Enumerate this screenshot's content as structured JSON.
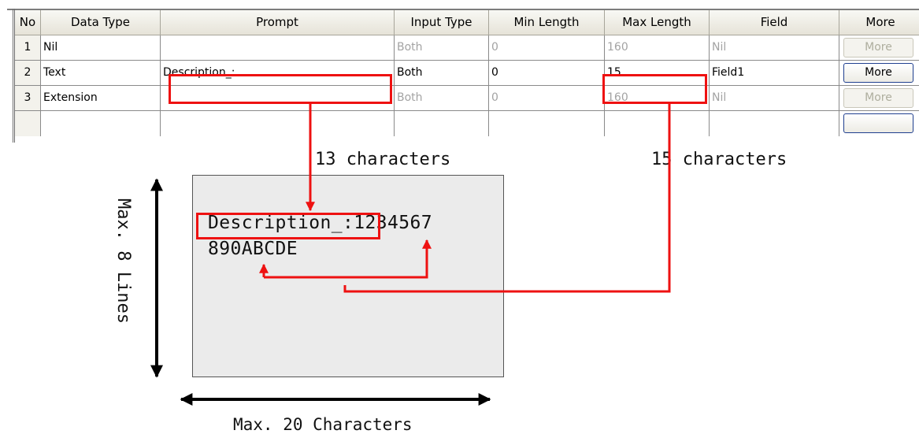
{
  "grid": {
    "headers": [
      "No",
      "Data Type",
      "Prompt",
      "Input Type",
      "Min Length",
      "Max Length",
      "Field",
      "More"
    ],
    "rows": [
      {
        "no": "1",
        "data_type": "Nil",
        "prompt": "",
        "input_type": "Both",
        "min_length": "0",
        "max_length": "160",
        "field": "Nil",
        "more": "More",
        "enabled": false
      },
      {
        "no": "2",
        "data_type": "Text",
        "prompt": "Description_:",
        "input_type": "Both",
        "min_length": "0",
        "max_length": "15",
        "field": "Field1",
        "more": "More",
        "enabled": true
      },
      {
        "no": "3",
        "data_type": "Extension",
        "prompt": "",
        "input_type": "Both",
        "min_length": "0",
        "max_length": "160",
        "field": "Nil",
        "more": "More",
        "enabled": false
      }
    ]
  },
  "diagram": {
    "prompt_count_label": "13 characters",
    "max_count_label": "15 characters",
    "screen_line1_prompt": "Description_",
    "screen_line1_rest": ":1234567",
    "screen_line2": "890ABCDE",
    "height_label": "Max. 8 Lines",
    "width_label": "Max. 20 Characters"
  },
  "colors": {
    "highlight": "#ee1111",
    "screen_bg": "#ebebeb",
    "header_bg": "#ece9d8"
  }
}
